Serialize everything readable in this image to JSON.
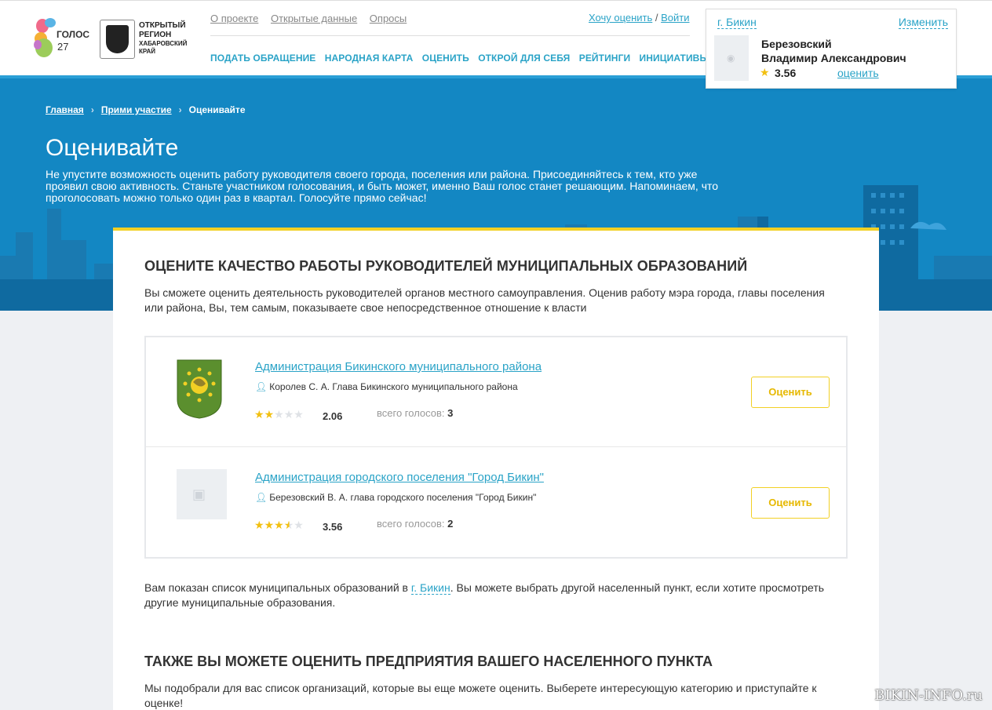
{
  "brand": {
    "golos_name": "ГОЛОС",
    "golos_num": "27",
    "region_line1": "ОТКРЫТЫЙ",
    "region_line2": "РЕГИОН",
    "region_line3": "ХАБАРОВСКИЙ",
    "region_line4": "КРАЙ"
  },
  "toplinks": [
    "О проекте",
    "Открытые данные",
    "Опросы"
  ],
  "auth": {
    "want_rate": "Хочу оценить",
    "sep": " / ",
    "login": "Войти"
  },
  "nav": [
    "ПОДАТЬ ОБРАЩЕНИЕ",
    "НАРОДНАЯ КАРТА",
    "ОЦЕНИТЬ",
    "ОТКРОЙ ДЛЯ СЕБЯ",
    "РЕЙТИНГИ",
    "ИНИЦИАТИВЫ"
  ],
  "user_card": {
    "city": "г. Бикин",
    "change": "Изменить",
    "name_line1": "Березовский",
    "name_line2": "Владимир Александрович",
    "score": "3.56",
    "rate": "оценить"
  },
  "breadcrumb": [
    "Главная",
    "Прими участие",
    "Оценивайте"
  ],
  "hero": {
    "title": "Оценивайте",
    "text": "Не упустите возможность оценить работу руководителя своего города, поселения или района. Присоединяйтесь к тем, кто уже проявил свою активность. Станьте участником голосования, и быть может, именно Ваш голос станет решающим. Напоминаем, что проголосовать можно только один раз в квартал. Голосуйте прямо сейчас!"
  },
  "section1": {
    "title": "ОЦЕНИТЕ КАЧЕСТВО РАБОТЫ РУКОВОДИТЕЛЕЙ МУНИЦИПАЛЬНЫХ ОБРАЗОВАНИЙ",
    "lead": "Вы сможете оценить деятельность руководителей органов местного самоуправления. Оценив работу мэра города, главы поселения или района, Вы, тем самым, показываете свое непосредственное отношение к власти"
  },
  "items": [
    {
      "title": "Администрация Бикинского муниципального района",
      "head": "Королев С. А. Глава Бикинского муниципального района",
      "rating": 2.06,
      "score": "2.06",
      "votes_label": "всего голосов:",
      "votes": "3",
      "button": "Оценить"
    },
    {
      "title": "Администрация городского поселения \"Город Бикин\"",
      "head": "Березовский В. А. глава городского поселения \"Город Бикин\"",
      "rating": 3.56,
      "score": "3.56",
      "votes_label": "всего голосов:",
      "votes": "2",
      "button": "Оценить"
    }
  ],
  "note": {
    "before": "Вам показан список муниципальных образований в ",
    "city": "г. Бикин",
    "after": ". Вы можете выбрать другой населенный пункт, если хотите просмотреть другие муниципальные образования."
  },
  "section2": {
    "title": "ТАКЖЕ ВЫ МОЖЕТЕ ОЦЕНИТЬ ПРЕДПРИЯТИЯ ВАШЕГО НАСЕЛЕННОГО ПУНКТА",
    "lead": "Мы подобрали для вас список организаций, которые вы еще можете оценить. Выберете интересующую категорию и приступайте к оценке!"
  },
  "watermark": "BIKIN-INFO.ru",
  "colors": {
    "accent": "#2aa3c7",
    "hero": "#1387c3",
    "yellow": "#f2d024",
    "star": "#f2c011"
  }
}
